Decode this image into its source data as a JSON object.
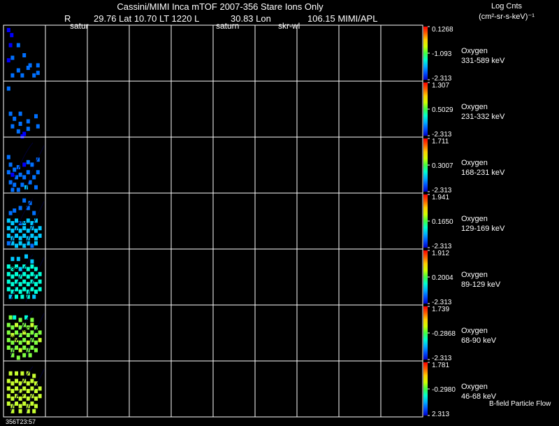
{
  "header": {
    "title": "Cassini/MIMI Inca mTOF  2007-356   Stare    Ions Only",
    "subtitle": [
      "R",
      "29.76 Lat 10.70 LT 1220 L",
      "30.83 Lon",
      "106.15  MIMI/APL"
    ],
    "markers": [
      "satur",
      "saturn",
      "skr-wl"
    ],
    "scale_title": "Log Cnts",
    "scale_units": "(cm²-sr-s-keV)⁻¹"
  },
  "footer": {
    "time_label": "356T23:57",
    "legend_note": "B-field Particle Flow"
  },
  "colors": {
    "background": "#000000",
    "grid": "#ffffff",
    "colorbar": [
      "#0000cc",
      "#0050ff",
      "#00b0ff",
      "#00ffd0",
      "#40ff40",
      "#d0ff00",
      "#ffd000",
      "#ff6000",
      "#ff0000"
    ]
  },
  "chart_data": {
    "type": "heatmap",
    "columns": 10,
    "panels": [
      {
        "species": "Oxygen",
        "energy": "331-589 keV",
        "max": "0.1268",
        "mid": "-1.093",
        "min": "-2.313",
        "data": [
          [
            0,
            0.05,
            0.0
          ],
          [
            0,
            0.13,
            0.1
          ],
          [
            0,
            0.1,
            0.3
          ],
          [
            0,
            0.05,
            0.6
          ],
          [
            1,
            0.3,
            0.3
          ],
          [
            1,
            0.15,
            0.55
          ],
          [
            1,
            0.45,
            0.5
          ],
          [
            1,
            0.3,
            0.8
          ],
          [
            1,
            0.55,
            0.75
          ],
          [
            1,
            0.6,
            0.7
          ],
          [
            1,
            0.8,
            0.7
          ],
          [
            1,
            0.15,
            0.9
          ],
          [
            1,
            0.4,
            0.9
          ],
          [
            1,
            0.7,
            0.9
          ],
          [
            1,
            0.8,
            0.85
          ]
        ],
        "labels": []
      },
      {
        "species": "Oxygen",
        "energy": "231-332 keV",
        "max": "1.307",
        "mid": "0.5029",
        "min": "-2.313",
        "data": [
          [
            1,
            0.05,
            0.05
          ],
          [
            1,
            0.1,
            0.55
          ],
          [
            1,
            0.2,
            0.65
          ],
          [
            1,
            0.35,
            0.55
          ],
          [
            1,
            0.15,
            0.8
          ],
          [
            1,
            0.35,
            0.75
          ],
          [
            1,
            0.55,
            0.7
          ],
          [
            1,
            0.55,
            0.85
          ],
          [
            1,
            0.75,
            0.6
          ],
          [
            1,
            0.8,
            0.8
          ],
          [
            1,
            0.3,
            0.9
          ],
          [
            0,
            0.45,
            0.95
          ],
          [
            0,
            0.4,
            1.0
          ]
        ],
        "labels": []
      },
      {
        "species": "Oxygen",
        "energy": "168-231 keV",
        "max": "1.711",
        "mid": "0.3007",
        "min": "-2.313",
        "data": [
          [
            1,
            0.05,
            0.3
          ],
          [
            1,
            0.1,
            0.45
          ],
          [
            1,
            0.2,
            0.55
          ],
          [
            1,
            0.3,
            0.5
          ],
          [
            0,
            0.45,
            0.45
          ],
          [
            1,
            0.55,
            0.4
          ],
          [
            1,
            0.65,
            0.45
          ],
          [
            1,
            0.8,
            0.35
          ],
          [
            1,
            0.05,
            0.6
          ],
          [
            0,
            0.15,
            0.65
          ],
          [
            1,
            0.25,
            0.7
          ],
          [
            1,
            0.35,
            0.65
          ],
          [
            1,
            0.45,
            0.7
          ],
          [
            1,
            0.55,
            0.6
          ],
          [
            1,
            0.7,
            0.7
          ],
          [
            1,
            0.8,
            0.6
          ],
          [
            1,
            0.1,
            0.8
          ],
          [
            1,
            0.2,
            0.85
          ],
          [
            1,
            0.4,
            0.85
          ],
          [
            1,
            0.6,
            0.8
          ],
          [
            1,
            0.75,
            0.9
          ],
          [
            1,
            0.3,
            0.95
          ],
          [
            2,
            0.5,
            0.9
          ],
          [
            1,
            0.15,
            0.95
          ]
        ],
        "labels": [
          {
            "text": "30",
            "x": 0.6,
            "y": 0.4
          }
        ]
      },
      {
        "species": "Oxygen",
        "energy": "129-169 keV",
        "max": "1.941",
        "mid": "0.1650",
        "min": "-2.313",
        "data": [
          [
            1,
            0.1,
            0.3
          ],
          [
            1,
            0.2,
            0.25
          ],
          [
            1,
            0.35,
            0.2
          ],
          [
            1,
            0.55,
            0.2
          ],
          [
            1,
            0.7,
            0.3
          ],
          [
            2,
            0.05,
            0.45
          ],
          [
            2,
            0.15,
            0.5
          ],
          [
            2,
            0.25,
            0.45
          ],
          [
            1,
            0.35,
            0.5
          ],
          [
            2,
            0.45,
            0.5
          ],
          [
            2,
            0.55,
            0.45
          ],
          [
            2,
            0.65,
            0.5
          ],
          [
            2,
            0.75,
            0.45
          ],
          [
            2,
            0.05,
            0.6
          ],
          [
            2,
            0.15,
            0.65
          ],
          [
            2,
            0.25,
            0.6
          ],
          [
            2,
            0.35,
            0.65
          ],
          [
            2,
            0.45,
            0.6
          ],
          [
            2,
            0.55,
            0.65
          ],
          [
            2,
            0.65,
            0.6
          ],
          [
            2,
            0.75,
            0.65
          ],
          [
            2,
            0.85,
            0.6
          ],
          [
            2,
            0.05,
            0.75
          ],
          [
            2,
            0.15,
            0.8
          ],
          [
            2,
            0.25,
            0.75
          ],
          [
            2,
            0.35,
            0.8
          ],
          [
            2,
            0.45,
            0.75
          ],
          [
            2,
            0.55,
            0.8
          ],
          [
            2,
            0.65,
            0.75
          ],
          [
            2,
            0.75,
            0.8
          ],
          [
            2,
            0.85,
            0.75
          ],
          [
            1,
            0.05,
            0.9
          ],
          [
            2,
            0.15,
            0.9
          ],
          [
            2,
            0.25,
            0.95
          ],
          [
            2,
            0.35,
            0.9
          ],
          [
            2,
            0.45,
            0.95
          ],
          [
            2,
            0.55,
            0.9
          ],
          [
            1,
            0.65,
            0.95
          ],
          [
            2,
            0.75,
            0.9
          ],
          [
            1,
            0.45,
            0.05
          ],
          [
            1,
            0.6,
            0.1
          ]
        ],
        "labels": [
          {
            "text": "30",
            "x": 0.35,
            "y": 0.55
          }
        ]
      },
      {
        "species": "Oxygen",
        "energy": "89-129 keV",
        "max": "1.912",
        "mid": "0.2004",
        "min": "-2.313",
        "data": [
          [
            2,
            0.15,
            0.1
          ],
          [
            2,
            0.3,
            0.1
          ],
          [
            2,
            0.5,
            0.05
          ],
          [
            2,
            0.65,
            0.15
          ],
          [
            3,
            0.05,
            0.25
          ],
          [
            3,
            0.15,
            0.3
          ],
          [
            3,
            0.25,
            0.25
          ],
          [
            2,
            0.35,
            0.3
          ],
          [
            3,
            0.45,
            0.25
          ],
          [
            3,
            0.55,
            0.3
          ],
          [
            3,
            0.65,
            0.25
          ],
          [
            3,
            0.75,
            0.3
          ],
          [
            3,
            0.05,
            0.4
          ],
          [
            3,
            0.15,
            0.45
          ],
          [
            3,
            0.25,
            0.4
          ],
          [
            3,
            0.35,
            0.45
          ],
          [
            3,
            0.45,
            0.4
          ],
          [
            3,
            0.55,
            0.45
          ],
          [
            3,
            0.65,
            0.4
          ],
          [
            3,
            0.75,
            0.45
          ],
          [
            3,
            0.85,
            0.4
          ],
          [
            3,
            0.05,
            0.55
          ],
          [
            3,
            0.15,
            0.6
          ],
          [
            3,
            0.25,
            0.55
          ],
          [
            3,
            0.35,
            0.6
          ],
          [
            3,
            0.45,
            0.55
          ],
          [
            3,
            0.55,
            0.6
          ],
          [
            3,
            0.65,
            0.55
          ],
          [
            3,
            0.75,
            0.6
          ],
          [
            3,
            0.85,
            0.55
          ],
          [
            3,
            0.05,
            0.7
          ],
          [
            3,
            0.15,
            0.75
          ],
          [
            3,
            0.25,
            0.7
          ],
          [
            3,
            0.35,
            0.75
          ],
          [
            3,
            0.45,
            0.7
          ],
          [
            3,
            0.55,
            0.75
          ],
          [
            3,
            0.65,
            0.7
          ],
          [
            3,
            0.75,
            0.75
          ],
          [
            3,
            0.85,
            0.7
          ],
          [
            2,
            0.1,
            0.85
          ],
          [
            3,
            0.25,
            0.85
          ],
          [
            3,
            0.4,
            0.85
          ],
          [
            3,
            0.55,
            0.85
          ],
          [
            2,
            0.7,
            0.85
          ]
        ],
        "labels": [
          {
            "text": "30",
            "x": 0.15,
            "y": 0.4
          }
        ]
      },
      {
        "species": "Oxygen",
        "energy": "68-90 keV",
        "max": "1.739",
        "mid": "-0.2868",
        "min": "-2.313",
        "data": [
          [
            4,
            0.1,
            0.15
          ],
          [
            3,
            0.2,
            0.15
          ],
          [
            4,
            0.35,
            0.2
          ],
          [
            3,
            0.5,
            0.15
          ],
          [
            4,
            0.65,
            0.2
          ],
          [
            4,
            0.05,
            0.3
          ],
          [
            4,
            0.15,
            0.35
          ],
          [
            5,
            0.25,
            0.3
          ],
          [
            4,
            0.35,
            0.35
          ],
          [
            4,
            0.45,
            0.3
          ],
          [
            4,
            0.55,
            0.35
          ],
          [
            5,
            0.65,
            0.3
          ],
          [
            4,
            0.75,
            0.35
          ],
          [
            4,
            0.05,
            0.45
          ],
          [
            5,
            0.15,
            0.5
          ],
          [
            4,
            0.25,
            0.45
          ],
          [
            4,
            0.35,
            0.5
          ],
          [
            5,
            0.45,
            0.45
          ],
          [
            4,
            0.55,
            0.5
          ],
          [
            4,
            0.65,
            0.45
          ],
          [
            4,
            0.75,
            0.5
          ],
          [
            4,
            0.85,
            0.45
          ],
          [
            4,
            0.05,
            0.6
          ],
          [
            4,
            0.15,
            0.65
          ],
          [
            5,
            0.25,
            0.6
          ],
          [
            4,
            0.35,
            0.65
          ],
          [
            4,
            0.45,
            0.6
          ],
          [
            5,
            0.55,
            0.65
          ],
          [
            4,
            0.65,
            0.6
          ],
          [
            4,
            0.75,
            0.65
          ],
          [
            5,
            0.85,
            0.6
          ],
          [
            4,
            0.05,
            0.75
          ],
          [
            4,
            0.15,
            0.8
          ],
          [
            4,
            0.25,
            0.75
          ],
          [
            5,
            0.35,
            0.8
          ],
          [
            4,
            0.45,
            0.75
          ],
          [
            4,
            0.55,
            0.8
          ],
          [
            4,
            0.65,
            0.75
          ],
          [
            4,
            0.75,
            0.8
          ],
          [
            4,
            0.15,
            0.9
          ],
          [
            4,
            0.3,
            0.95
          ],
          [
            4,
            0.45,
            0.9
          ],
          [
            4,
            0.6,
            0.9
          ]
        ],
        "labels": [
          {
            "text": "60",
            "x": 0.45,
            "y": 0.48
          },
          {
            "text": "30",
            "x": 0.15,
            "y": 0.65
          }
        ]
      },
      {
        "species": "Oxygen",
        "energy": "46-68 keV",
        "max": "1.781",
        "mid": "-0.2980",
        "min": "2.313",
        "data": [
          [
            5,
            0.1,
            0.15
          ],
          [
            5,
            0.25,
            0.15
          ],
          [
            5,
            0.4,
            0.15
          ],
          [
            5,
            0.55,
            0.15
          ],
          [
            5,
            0.7,
            0.2
          ],
          [
            5,
            0.05,
            0.3
          ],
          [
            5,
            0.15,
            0.35
          ],
          [
            5,
            0.25,
            0.3
          ],
          [
            5,
            0.35,
            0.35
          ],
          [
            5,
            0.45,
            0.3
          ],
          [
            5,
            0.55,
            0.35
          ],
          [
            5,
            0.65,
            0.3
          ],
          [
            5,
            0.75,
            0.35
          ],
          [
            5,
            0.05,
            0.45
          ],
          [
            5,
            0.15,
            0.5
          ],
          [
            5,
            0.25,
            0.45
          ],
          [
            5,
            0.35,
            0.5
          ],
          [
            5,
            0.45,
            0.45
          ],
          [
            5,
            0.55,
            0.5
          ],
          [
            5,
            0.65,
            0.45
          ],
          [
            5,
            0.75,
            0.5
          ],
          [
            5,
            0.85,
            0.45
          ],
          [
            5,
            0.05,
            0.6
          ],
          [
            5,
            0.15,
            0.65
          ],
          [
            5,
            0.25,
            0.6
          ],
          [
            5,
            0.35,
            0.65
          ],
          [
            5,
            0.45,
            0.6
          ],
          [
            5,
            0.55,
            0.65
          ],
          [
            5,
            0.65,
            0.6
          ],
          [
            5,
            0.75,
            0.65
          ],
          [
            5,
            0.85,
            0.6
          ],
          [
            5,
            0.05,
            0.75
          ],
          [
            5,
            0.15,
            0.8
          ],
          [
            5,
            0.25,
            0.75
          ],
          [
            5,
            0.35,
            0.8
          ],
          [
            5,
            0.45,
            0.75
          ],
          [
            5,
            0.55,
            0.8
          ],
          [
            5,
            0.65,
            0.75
          ],
          [
            5,
            0.75,
            0.8
          ],
          [
            5,
            0.15,
            0.9
          ],
          [
            5,
            0.35,
            0.9
          ],
          [
            5,
            0.55,
            0.9
          ],
          [
            5,
            0.7,
            0.9
          ]
        ],
        "labels": [
          {
            "text": "30",
            "x": 0.3,
            "y": 0.65
          }
        ]
      }
    ]
  }
}
